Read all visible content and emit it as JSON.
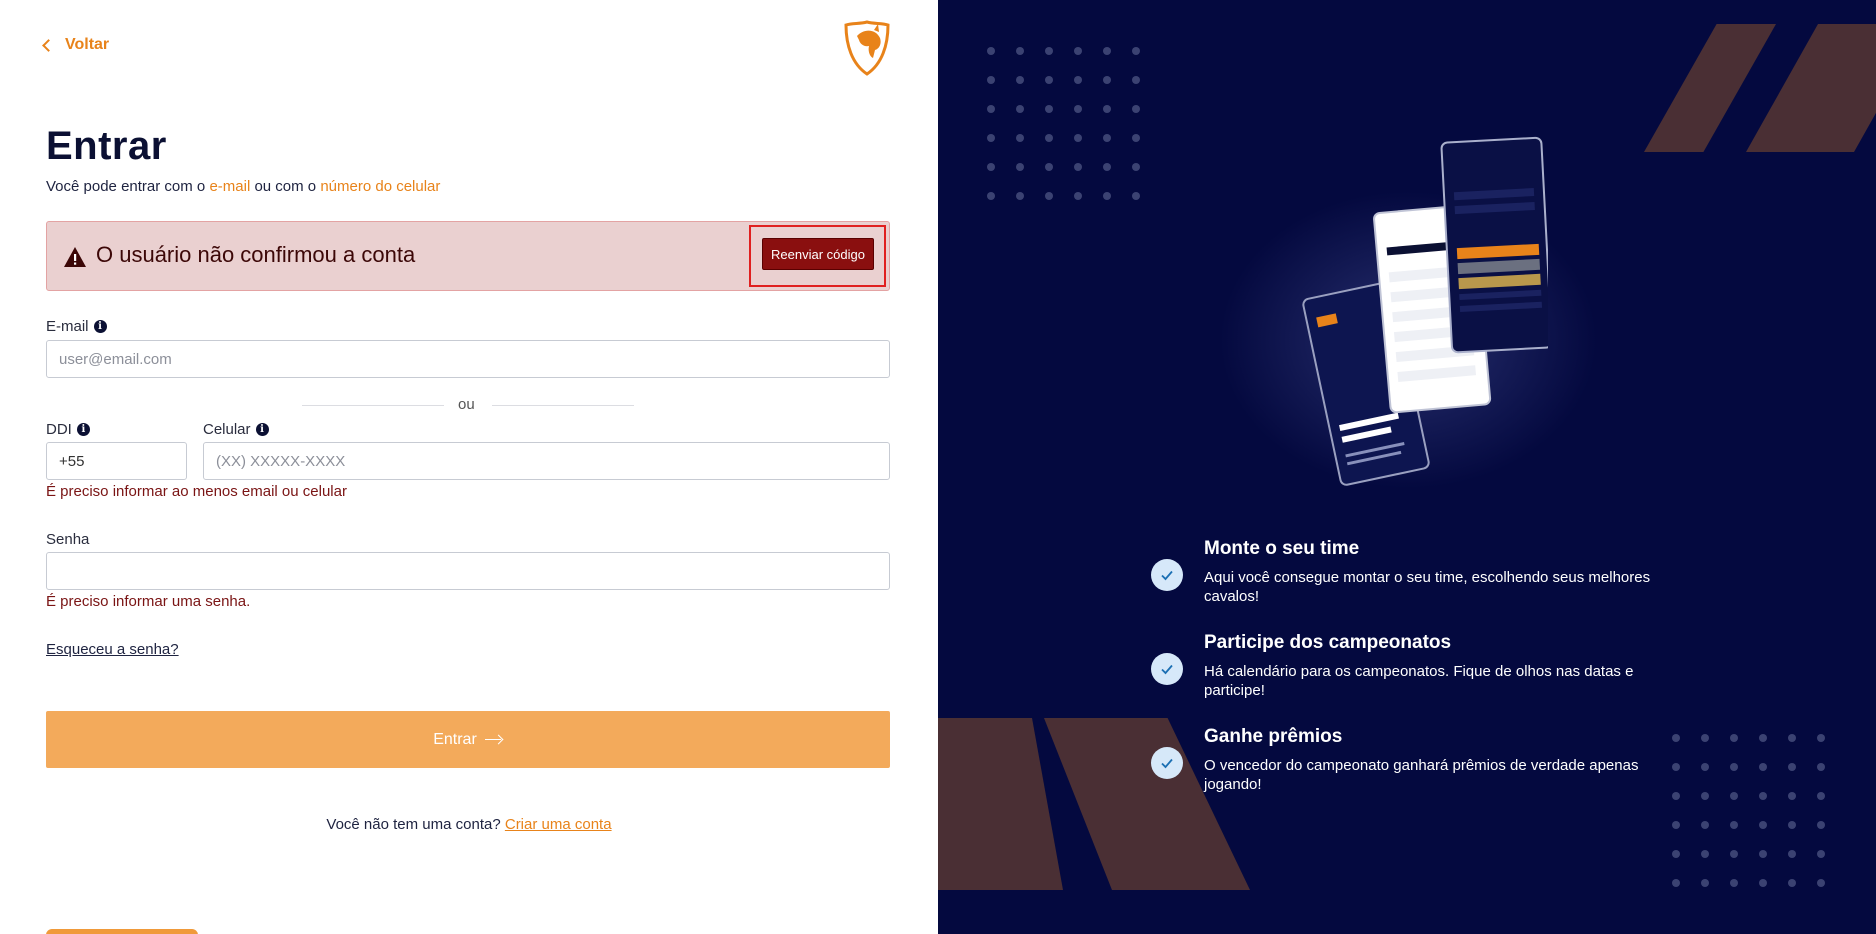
{
  "nav": {
    "back_label": "Voltar"
  },
  "login": {
    "title": "Entrar",
    "subtitle_prefix": "Você pode entrar com o ",
    "subtitle_email": "e-mail",
    "subtitle_middle": " ou com o ",
    "subtitle_phone": "número do celular"
  },
  "alert": {
    "message": "O usuário não confirmou a conta",
    "resend_label": "Reenviar código"
  },
  "email": {
    "label": "E-mail",
    "placeholder": "user@email.com",
    "value": ""
  },
  "separator": {
    "label": "ou"
  },
  "ddi": {
    "label": "DDI",
    "value": "+55"
  },
  "phone": {
    "label": "Celular",
    "placeholder": "(XX) XXXXX-XXXX",
    "value": ""
  },
  "phone_error": "É preciso informar ao menos email ou celular",
  "password": {
    "label": "Senha",
    "value": "",
    "error": "É preciso informar uma senha."
  },
  "forgot_label": "Esqueceu a senha?",
  "submit_label": "Entrar",
  "signup": {
    "prompt": "Você não tem uma conta? ",
    "link": "Criar uma conta"
  },
  "features": [
    {
      "title": "Monte o seu time",
      "description": "Aqui você consegue montar o seu time, escolhendo seus melhores cavalos!"
    },
    {
      "title": "Participe dos campeonatos",
      "description": "Há calendário para os campeonatos. Fique de olhos nas datas e participe!"
    },
    {
      "title": "Ganhe prêmios",
      "description": "O vencedor do campeonato ganhará prêmios de verdade apenas jogando!"
    }
  ],
  "colors": {
    "accent": "#e8831a",
    "submit_bg": "#f3aa5b",
    "alert_bg": "#ead0d0",
    "resend_bg": "#8a0f0f",
    "right_bg": "#04093f",
    "stripe": "#4a2f34"
  }
}
